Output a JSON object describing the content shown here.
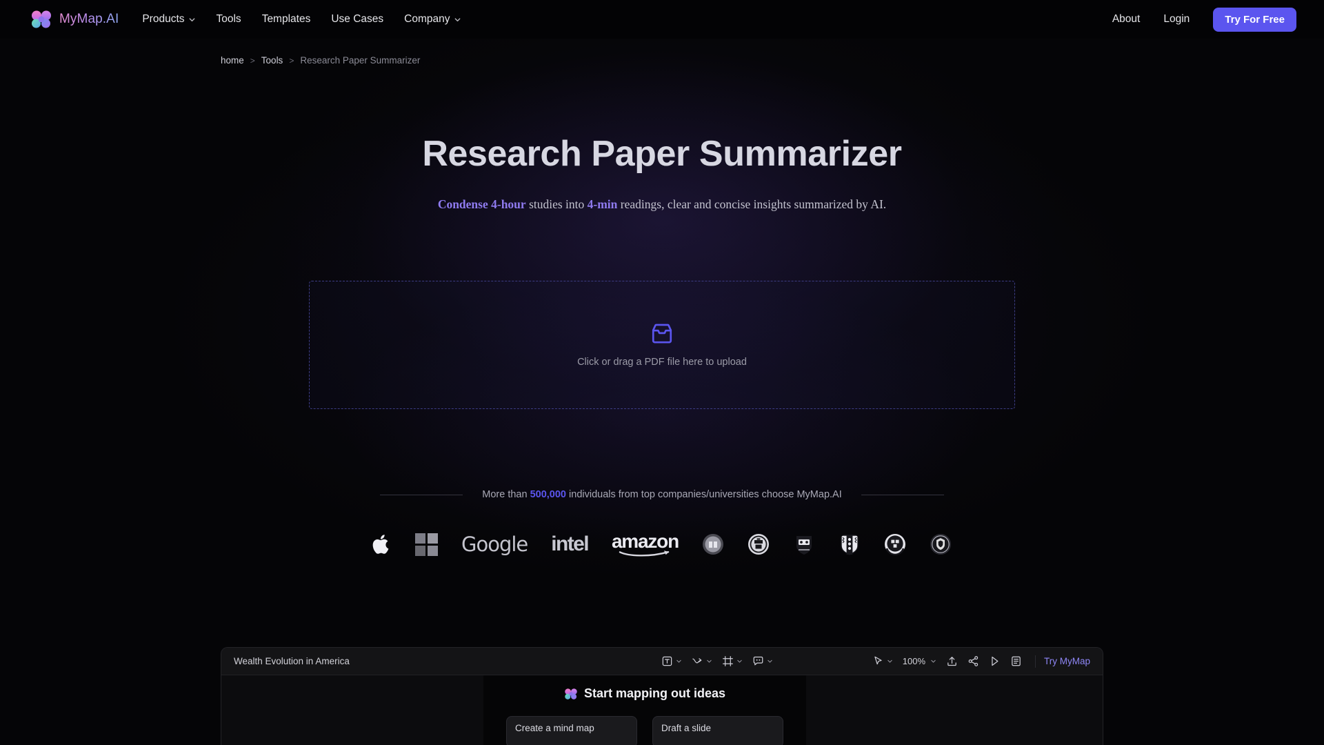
{
  "brand": {
    "name": "MyMap.AI",
    "logo_icon": "mymap-cluster-logo"
  },
  "nav": {
    "items": [
      {
        "label": "Products",
        "has_caret": true
      },
      {
        "label": "Tools",
        "has_caret": false
      },
      {
        "label": "Templates",
        "has_caret": false
      },
      {
        "label": "Use Cases",
        "has_caret": false
      },
      {
        "label": "Company",
        "has_caret": true
      }
    ],
    "about_label": "About",
    "login_label": "Login",
    "cta_label": "Try For Free",
    "cta_color": "#5b55ef"
  },
  "breadcrumb": {
    "home": "home",
    "sep1": ">",
    "tools": "Tools",
    "sep2": ">",
    "current": "Research Paper Summarizer"
  },
  "hero": {
    "title": "Research Paper Summarizer",
    "sub_hl1": "Condense 4-hour",
    "sub_mid": " studies into ",
    "sub_hl2": "4-min",
    "sub_tail": " readings, clear and concise insights summarized by AI.",
    "highlight_color": "#8f7bf0"
  },
  "upload": {
    "icon": "inbox-tray-icon",
    "prompt": "Click or drag a PDF file here to upload",
    "border_color": "#3d3d86",
    "icon_color": "#5b55ef"
  },
  "social_proof": {
    "prefix": "More than ",
    "count": "500,000",
    "suffix": " individuals from top companies/universities choose MyMap.AI",
    "count_color": "#5b55ef",
    "logos": [
      {
        "name": "apple",
        "type": "glyph",
        "text": ""
      },
      {
        "name": "microsoft",
        "type": "grid",
        "text": ""
      },
      {
        "name": "google",
        "type": "word",
        "text": "Google"
      },
      {
        "name": "intel",
        "type": "word",
        "text": "intel"
      },
      {
        "name": "amazon",
        "type": "word",
        "text": "amazon"
      },
      {
        "name": "university-crest-1",
        "type": "crest",
        "text": ""
      },
      {
        "name": "university-crest-2",
        "type": "crest",
        "text": ""
      },
      {
        "name": "university-crest-3",
        "type": "crest",
        "text": ""
      },
      {
        "name": "university-crest-4",
        "type": "crest",
        "text": ""
      },
      {
        "name": "university-crest-5",
        "type": "crest",
        "text": ""
      },
      {
        "name": "university-crest-6",
        "type": "crest",
        "text": ""
      }
    ]
  },
  "app_preview": {
    "doc_title": "Wealth Evolution in America",
    "tools": [
      {
        "icon": "text-tool-icon",
        "has_caret": true
      },
      {
        "icon": "connector-arrow-icon",
        "has_caret": true
      },
      {
        "icon": "frame-tool-icon",
        "has_caret": true
      },
      {
        "icon": "comment-tool-icon",
        "has_caret": true
      }
    ],
    "right_tools": [
      {
        "icon": "cursor-icon",
        "has_caret": true
      },
      {
        "icon": "upload-icon",
        "has_caret": false
      },
      {
        "icon": "share-icon",
        "has_caret": false
      },
      {
        "icon": "present-play-icon",
        "has_caret": false
      },
      {
        "icon": "outline-list-icon",
        "has_caret": false
      }
    ],
    "zoom_level": "100%",
    "try_mymap_label": "Try MyMap",
    "try_mymap_color": "#8e86f5",
    "modal": {
      "title": "Start mapping out ideas",
      "icon": "mymap-cluster-logo",
      "cards": [
        {
          "label": "Create a mind map"
        },
        {
          "label": "Draft a slide"
        }
      ]
    }
  }
}
